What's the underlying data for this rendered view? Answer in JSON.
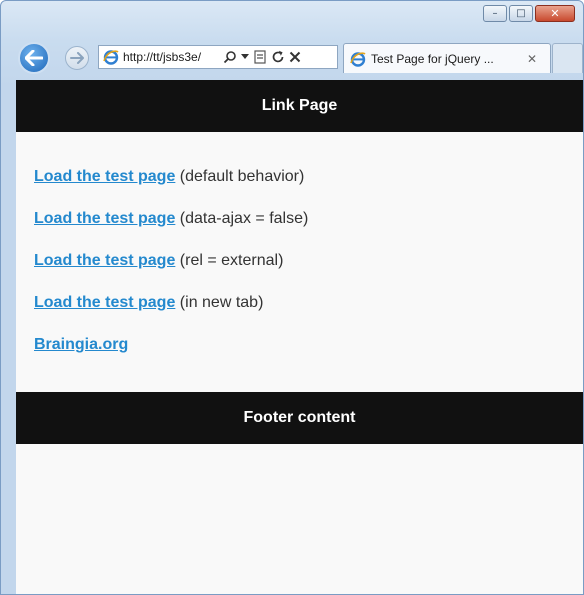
{
  "browser": {
    "address_url": "http://tt/jsbs3e/",
    "tab_title": "Test Page for jQuery ...",
    "window_buttons": {
      "minimize": "–",
      "maximize": "□",
      "close": "✕"
    },
    "icons": [
      "back-arrow-icon",
      "forward-arrow-icon",
      "ie-logo-icon",
      "search-icon",
      "dropdown-icon",
      "compatibility-icon",
      "refresh-icon",
      "stop-icon",
      "close-tab-icon"
    ]
  },
  "page": {
    "header_title": "Link Page",
    "links": [
      {
        "link_text": "Load the test page",
        "note": " (default behavior)"
      },
      {
        "link_text": "Load the test page",
        "note": " (data-ajax = false)"
      },
      {
        "link_text": "Load the test page",
        "note": " (rel = external)"
      },
      {
        "link_text": "Load the test page",
        "note": " (in new tab)"
      },
      {
        "link_text": "Braingia.org",
        "note": ""
      }
    ],
    "footer_text": "Footer content"
  },
  "colors": {
    "bar_background": "#111111",
    "link": "#2489ce",
    "page_background": "#f9f9f9",
    "chrome": "#c9dcef"
  }
}
